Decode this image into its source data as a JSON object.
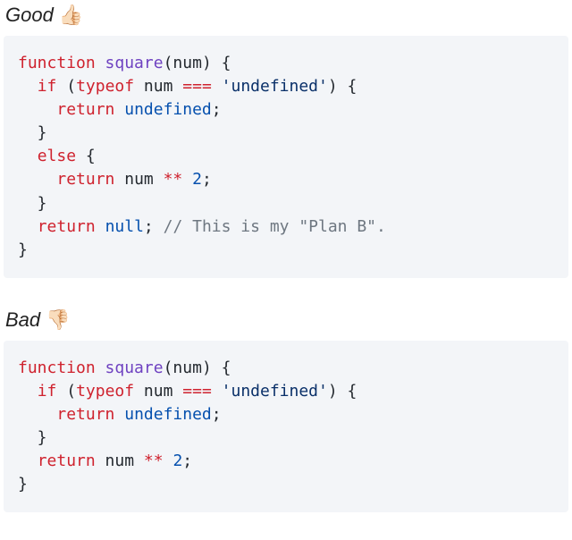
{
  "headings": {
    "good": {
      "label": "Good",
      "icon": "👍🏻"
    },
    "bad": {
      "label": "Bad",
      "icon": "👎🏻"
    }
  },
  "code_good": {
    "lines": [
      [
        {
          "t": "function",
          "c": "c-kw"
        },
        {
          "t": " ",
          "c": "tok"
        },
        {
          "t": "square",
          "c": "c-fn"
        },
        {
          "t": "(",
          "c": "c-punc"
        },
        {
          "t": "num",
          "c": "c-param"
        },
        {
          "t": ")",
          "c": "c-punc"
        },
        {
          "t": " {",
          "c": "c-punc"
        }
      ],
      [
        {
          "t": "  ",
          "c": "tok"
        },
        {
          "t": "if",
          "c": "c-kw"
        },
        {
          "t": " (",
          "c": "c-punc"
        },
        {
          "t": "typeof",
          "c": "c-kw"
        },
        {
          "t": " num ",
          "c": "c-param"
        },
        {
          "t": "===",
          "c": "c-op"
        },
        {
          "t": " ",
          "c": "tok"
        },
        {
          "t": "'undefined'",
          "c": "c-str"
        },
        {
          "t": ") {",
          "c": "c-punc"
        }
      ],
      [
        {
          "t": "    ",
          "c": "tok"
        },
        {
          "t": "return",
          "c": "c-kw"
        },
        {
          "t": " ",
          "c": "tok"
        },
        {
          "t": "undefined",
          "c": "c-const"
        },
        {
          "t": ";",
          "c": "c-punc"
        }
      ],
      [
        {
          "t": "  }",
          "c": "c-punc"
        }
      ],
      [
        {
          "t": "  ",
          "c": "tok"
        },
        {
          "t": "else",
          "c": "c-kw"
        },
        {
          "t": " {",
          "c": "c-punc"
        }
      ],
      [
        {
          "t": "    ",
          "c": "tok"
        },
        {
          "t": "return",
          "c": "c-kw"
        },
        {
          "t": " num ",
          "c": "c-param"
        },
        {
          "t": "**",
          "c": "c-op"
        },
        {
          "t": " ",
          "c": "tok"
        },
        {
          "t": "2",
          "c": "c-num"
        },
        {
          "t": ";",
          "c": "c-punc"
        }
      ],
      [
        {
          "t": "  }",
          "c": "c-punc"
        }
      ],
      [
        {
          "t": "  ",
          "c": "tok"
        },
        {
          "t": "return",
          "c": "c-kw"
        },
        {
          "t": " ",
          "c": "tok"
        },
        {
          "t": "null",
          "c": "c-const"
        },
        {
          "t": "; ",
          "c": "c-punc"
        },
        {
          "t": "// This is my \"Plan B\".",
          "c": "c-comment"
        }
      ],
      [
        {
          "t": "}",
          "c": "c-punc"
        }
      ]
    ]
  },
  "code_bad": {
    "lines": [
      [
        {
          "t": "function",
          "c": "c-kw"
        },
        {
          "t": " ",
          "c": "tok"
        },
        {
          "t": "square",
          "c": "c-fn"
        },
        {
          "t": "(",
          "c": "c-punc"
        },
        {
          "t": "num",
          "c": "c-param"
        },
        {
          "t": ")",
          "c": "c-punc"
        },
        {
          "t": " {",
          "c": "c-punc"
        }
      ],
      [
        {
          "t": "  ",
          "c": "tok"
        },
        {
          "t": "if",
          "c": "c-kw"
        },
        {
          "t": " (",
          "c": "c-punc"
        },
        {
          "t": "typeof",
          "c": "c-kw"
        },
        {
          "t": " num ",
          "c": "c-param"
        },
        {
          "t": "===",
          "c": "c-op"
        },
        {
          "t": " ",
          "c": "tok"
        },
        {
          "t": "'undefined'",
          "c": "c-str"
        },
        {
          "t": ") {",
          "c": "c-punc"
        }
      ],
      [
        {
          "t": "    ",
          "c": "tok"
        },
        {
          "t": "return",
          "c": "c-kw"
        },
        {
          "t": " ",
          "c": "tok"
        },
        {
          "t": "undefined",
          "c": "c-const"
        },
        {
          "t": ";",
          "c": "c-punc"
        }
      ],
      [
        {
          "t": "  }",
          "c": "c-punc"
        }
      ],
      [
        {
          "t": "  ",
          "c": "tok"
        },
        {
          "t": "return",
          "c": "c-kw"
        },
        {
          "t": " num ",
          "c": "c-param"
        },
        {
          "t": "**",
          "c": "c-op"
        },
        {
          "t": " ",
          "c": "tok"
        },
        {
          "t": "2",
          "c": "c-num"
        },
        {
          "t": ";",
          "c": "c-punc"
        }
      ],
      [
        {
          "t": "}",
          "c": "c-punc"
        }
      ]
    ]
  }
}
